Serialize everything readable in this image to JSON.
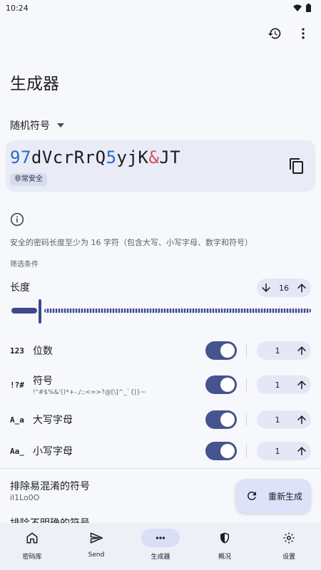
{
  "status_bar": {
    "time": "10:24"
  },
  "page": {
    "title": "生成器"
  },
  "generator_type": {
    "selected": "随机符号"
  },
  "password": {
    "segments": [
      {
        "text": "97",
        "kind": "num"
      },
      {
        "text": "dVcrRrQ",
        "kind": "let"
      },
      {
        "text": "5",
        "kind": "num"
      },
      {
        "text": "yjK",
        "kind": "let"
      },
      {
        "text": "&",
        "kind": "sym"
      },
      {
        "text": "JT",
        "kind": "let"
      }
    ],
    "strength": "非常安全"
  },
  "info": {
    "text": "安全的密码长度至少为 16 字符（包含大写、小写字母、数字和符号）",
    "filter_label": "筛选条件"
  },
  "length": {
    "label": "长度",
    "value": "16",
    "fraction": 0.0
  },
  "options": [
    {
      "icon": "123",
      "label": "位数",
      "sub": "",
      "enabled": true,
      "min": "1"
    },
    {
      "icon": "!?#",
      "label": "符号",
      "sub": "!\"#$%&'()*+-./:;<=>?@[\\]^_`{|}~",
      "enabled": true,
      "min": "1"
    },
    {
      "icon": "A̲a",
      "label": "大写字母",
      "sub": "",
      "enabled": true,
      "min": "1"
    },
    {
      "icon": "Aa̲",
      "label": "小写字母",
      "sub": "",
      "enabled": true,
      "min": "1"
    }
  ],
  "exclude_ambiguous": {
    "title": "排除易混淆的符号",
    "sub": "il1Lo0O"
  },
  "exclude_unclear": {
    "title": "排除不明确的符号"
  },
  "fab": {
    "label": "重新生成"
  },
  "bottom_nav": [
    {
      "label": "密码库",
      "icon": "home-icon",
      "active": false
    },
    {
      "label": "Send",
      "icon": "send-icon",
      "active": false
    },
    {
      "label": "生成器",
      "icon": "generator-icon",
      "active": true
    },
    {
      "label": "概况",
      "icon": "shield-icon",
      "active": false
    },
    {
      "label": "设置",
      "icon": "settings-icon",
      "active": false
    }
  ]
}
